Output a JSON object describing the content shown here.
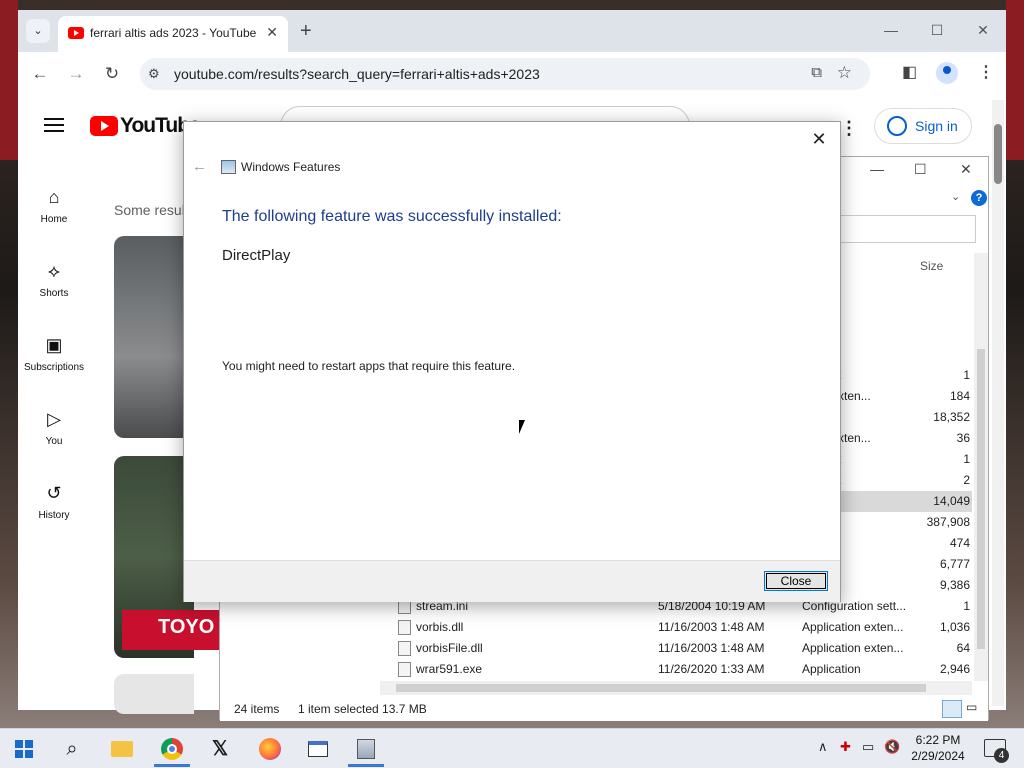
{
  "browser": {
    "tab_title": "ferrari altis ads 2023 - YouTube",
    "new_tab_label": "+",
    "url": "youtube.com/results?search_query=ferrari+altis+ads+2023"
  },
  "youtube": {
    "logo_text": "YouTube",
    "sign_in": "Sign in",
    "some_results": "Some resul",
    "nav": [
      {
        "label": "Home",
        "icon": "home-icon"
      },
      {
        "label": "Shorts",
        "icon": "shorts-icon"
      },
      {
        "label": "Subscriptions",
        "icon": "subscriptions-icon"
      },
      {
        "label": "You",
        "icon": "you-icon"
      },
      {
        "label": "History",
        "icon": "history-icon"
      }
    ],
    "thumb2_brand": "TOYO"
  },
  "explorer": {
    "size_header": "Size",
    "rows": [
      {
        "name": "",
        "date": "",
        "type": "ler",
        "size": ""
      },
      {
        "name": "",
        "date": "",
        "type": "ler",
        "size": ""
      },
      {
        "name": "",
        "date": "",
        "type": "ler",
        "size": ""
      },
      {
        "name": "",
        "date": "",
        "type": "ler",
        "size": ""
      },
      {
        "name": "",
        "date": "",
        "type": "cument",
        "size": "1"
      },
      {
        "name": "",
        "date": "",
        "type": "ation exten...",
        "size": "184"
      },
      {
        "name": "",
        "date": "",
        "type": "e",
        "size": "18,352"
      },
      {
        "name": "",
        "date": "",
        "type": "ation exten...",
        "size": "36"
      },
      {
        "name": "",
        "date": "",
        "type": "cument",
        "size": "1"
      },
      {
        "name": "",
        "date": "",
        "type": "cument",
        "size": "2"
      },
      {
        "name": "",
        "date": "",
        "type": "ation",
        "size": "14,049",
        "selected": true
      },
      {
        "name": "",
        "date": "",
        "type": "hive",
        "size": "387,908"
      },
      {
        "name": "",
        "date": "",
        "type": "hive",
        "size": "474"
      },
      {
        "name": "",
        "date": "",
        "type": "hive",
        "size": "6,777"
      },
      {
        "name": "",
        "date": "",
        "type": "ation",
        "size": "9,386"
      },
      {
        "name": "stream.ini",
        "date": "5/18/2004 10:19 AM",
        "type": "Configuration sett...",
        "size": "1"
      },
      {
        "name": "vorbis.dll",
        "date": "11/16/2003 1:48 AM",
        "type": "Application exten...",
        "size": "1,036"
      },
      {
        "name": "vorbisFile.dll",
        "date": "11/16/2003 1:48 AM",
        "type": "Application exten...",
        "size": "64"
      },
      {
        "name": "wrar591.exe",
        "date": "11/26/2020 1:33 AM",
        "type": "Application",
        "size": "2,946"
      }
    ],
    "status_count": "24 items",
    "status_selection": "1 item selected  13.7 MB"
  },
  "dialog": {
    "title": "Windows Features",
    "heading": "The following feature was successfully installed:",
    "feature": "DirectPlay",
    "note": "You might need to restart apps that require this feature.",
    "close_button": "Close"
  },
  "taskbar": {
    "time": "6:22 PM",
    "date": "2/29/2024",
    "notification_count": "4"
  }
}
